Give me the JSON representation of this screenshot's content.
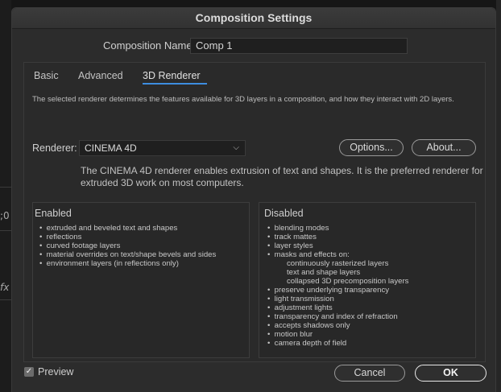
{
  "window": {
    "title": "Composition Settings"
  },
  "background_fragments": {
    "time_fragment": ";0",
    "fx_fragment": "fx"
  },
  "composition": {
    "name_label": "Composition Name:",
    "name_value": "Comp 1"
  },
  "tabs": [
    {
      "label": "Basic",
      "active": false
    },
    {
      "label": "Advanced",
      "active": false
    },
    {
      "label": "3D Renderer",
      "active": true
    }
  ],
  "accent_color": "#3d8de0",
  "description": "The selected renderer determines the features available for 3D layers in a composition, and how they interact with 2D layers.",
  "renderer": {
    "label": "Renderer:",
    "selected": "CINEMA 4D",
    "options_button": "Options...",
    "about_button": "About...",
    "note": "The CINEMA 4D renderer enables extrusion of text and shapes. It is the preferred renderer for extruded 3D work on most computers."
  },
  "enabled": {
    "title": "Enabled",
    "items": [
      "extruded and beveled text and shapes",
      "reflections",
      "curved footage layers",
      "material overrides on text/shape bevels and sides",
      "environment layers (in reflections only)"
    ]
  },
  "disabled": {
    "title": "Disabled",
    "items": [
      "blending modes",
      "track mattes",
      "layer styles",
      "masks and effects on:",
      "continuously rasterized layers",
      "text and shape layers",
      "collapsed 3D precomposition layers",
      "preserve underlying transparency",
      "light transmission",
      "adjustment lights",
      "transparency and index of refraction",
      "accepts shadows only",
      "motion blur",
      "camera depth of field"
    ]
  },
  "footer": {
    "preview_label": "Preview",
    "preview_checked": true,
    "cancel": "Cancel",
    "ok": "OK"
  }
}
